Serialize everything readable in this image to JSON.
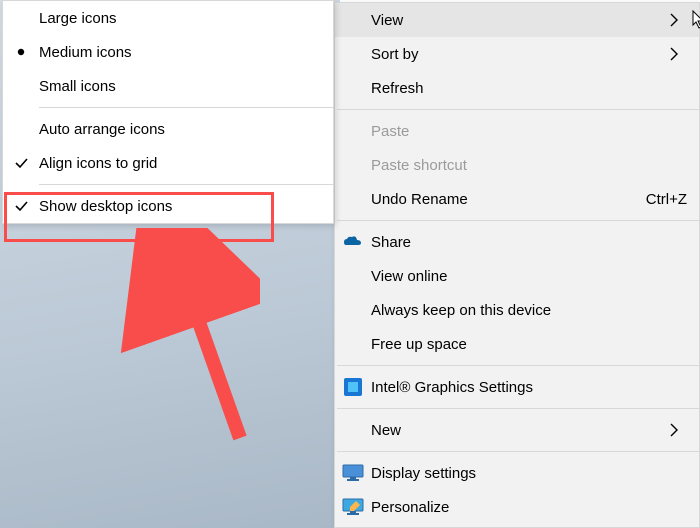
{
  "submenu": {
    "items": [
      {
        "label": "Large icons"
      },
      {
        "label": "Medium icons",
        "bullet": true
      },
      {
        "label": "Small icons"
      },
      {
        "label": "Auto arrange icons"
      },
      {
        "label": "Align icons to grid",
        "checked": true
      },
      {
        "label": "Show desktop icons",
        "checked": true
      }
    ]
  },
  "mainmenu": {
    "items": [
      {
        "label": "View",
        "submenu": true,
        "hover": true
      },
      {
        "label": "Sort by",
        "submenu": true
      },
      {
        "label": "Refresh"
      },
      {
        "label": "Paste",
        "disabled": true
      },
      {
        "label": "Paste shortcut",
        "disabled": true
      },
      {
        "label": "Undo Rename",
        "shortcut": "Ctrl+Z"
      },
      {
        "label": "Share",
        "icon": "onedrive-share"
      },
      {
        "label": "View online"
      },
      {
        "label": "Always keep on this device"
      },
      {
        "label": "Free up space"
      },
      {
        "label": "Intel® Graphics Settings",
        "icon": "intel"
      },
      {
        "label": "New",
        "submenu": true
      },
      {
        "label": "Display settings",
        "icon": "display"
      },
      {
        "label": "Personalize",
        "icon": "personalize"
      }
    ]
  }
}
